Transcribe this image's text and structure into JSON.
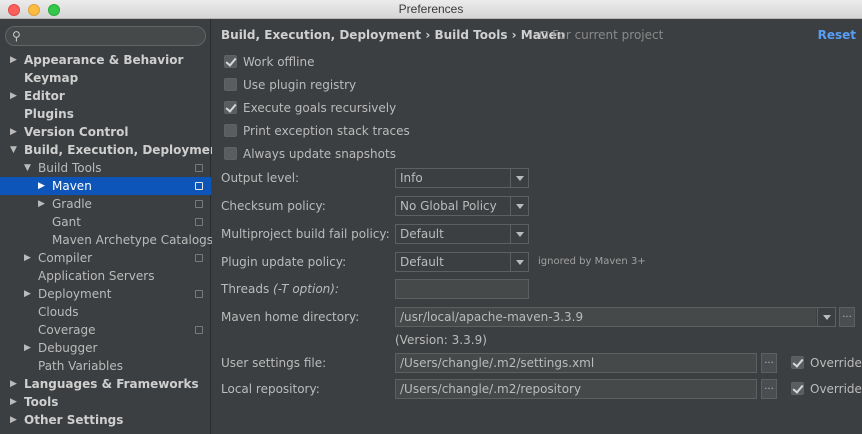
{
  "window": {
    "title": "Preferences"
  },
  "search": {
    "placeholder": ""
  },
  "tree": {
    "appearance": "Appearance & Behavior",
    "keymap": "Keymap",
    "editor": "Editor",
    "plugins": "Plugins",
    "version_control": "Version Control",
    "build": "Build, Execution, Deployment",
    "build_tools": "Build Tools",
    "maven": "Maven",
    "gradle": "Gradle",
    "gant": "Gant",
    "maven_archetype": "Maven Archetype Catalogs",
    "compiler": "Compiler",
    "app_servers": "Application Servers",
    "deployment": "Deployment",
    "clouds": "Clouds",
    "coverage": "Coverage",
    "debugger": "Debugger",
    "path_variables": "Path Variables",
    "languages": "Languages & Frameworks",
    "tools": "Tools",
    "other": "Other Settings"
  },
  "header": {
    "breadcrumb": "Build, Execution, Deployment › Build Tools › Maven",
    "scope_note": "For current project",
    "reset": "Reset"
  },
  "options": {
    "work_offline": {
      "label": "Work offline",
      "checked": true
    },
    "plugin_registry": {
      "label": "Use plugin registry",
      "checked": false
    },
    "goals_recursive": {
      "label": "Execute goals recursively",
      "checked": true
    },
    "stack_traces": {
      "label": "Print exception stack traces",
      "checked": false
    },
    "update_snapshots": {
      "label": "Always update snapshots",
      "checked": false
    }
  },
  "fields": {
    "output_level": {
      "label": "Output level:",
      "value": "Info"
    },
    "checksum_policy": {
      "label": "Checksum policy:",
      "value": "No Global Policy"
    },
    "fail_policy": {
      "label": "Multiproject build fail policy:",
      "value": "Default"
    },
    "plugin_update": {
      "label": "Plugin update policy:",
      "value": "Default",
      "hint": "ignored by Maven 3+"
    },
    "threads": {
      "label": "Threads",
      "label_em": "(-T option):",
      "value": ""
    },
    "maven_home": {
      "label": "Maven home directory:",
      "value": "/usr/local/apache-maven-3.3.9",
      "version": "(Version: 3.3.9)"
    },
    "user_settings": {
      "label": "User settings file:",
      "value": "/Users/changle/.m2/settings.xml",
      "override": "Override"
    },
    "local_repo": {
      "label": "Local repository:",
      "value": "/Users/changle/.m2/repository",
      "override": "Override"
    }
  },
  "browse_label": "...",
  "colors": {
    "selection": "#0d55b8",
    "accent_link": "#589df6",
    "background": "#3c3f41"
  }
}
